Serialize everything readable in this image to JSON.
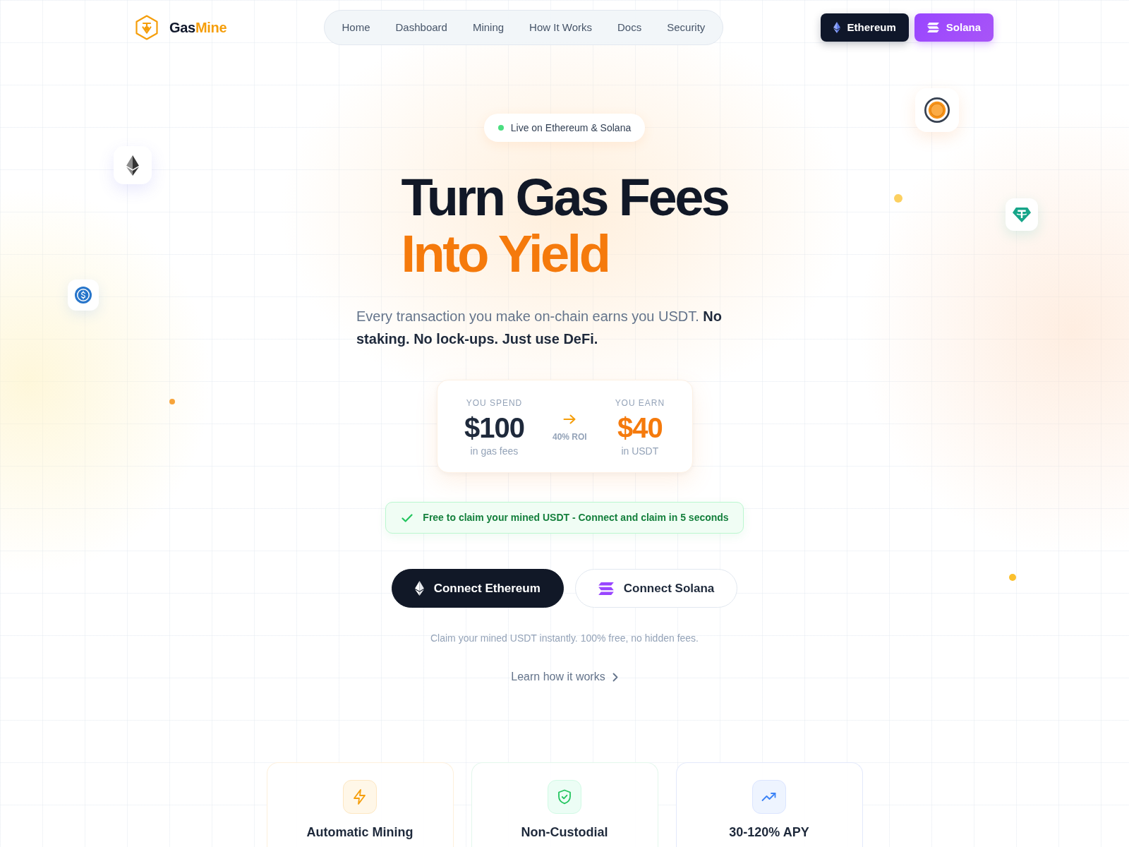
{
  "brand": {
    "name_start": "Gas",
    "name_end": "Mine"
  },
  "nav": [
    "Home",
    "Dashboard",
    "Mining",
    "How It Works",
    "Docs",
    "Security"
  ],
  "network_buttons": [
    {
      "label": "Ethereum",
      "kind": "ethereum"
    },
    {
      "label": "Solana",
      "kind": "solana"
    }
  ],
  "hero": {
    "badge": "Live on Ethereum & Solana",
    "title_line_1": "Turn Gas Fees",
    "title_line_2": "Into Yield",
    "subtitle": "Every transaction you make on-chain earns you USDT. **No staking. No lock-ups. Just use DeFi.**"
  },
  "calculator": {
    "spend": {
      "label": "YOU SPEND",
      "amount": "$100",
      "note": "in gas fees"
    },
    "ratio": "40% ROI",
    "earn": {
      "label": "YOU EARN",
      "amount": "$40",
      "note": "in USDT"
    }
  },
  "notice": "Free to claim your mined USDT - Connect and claim in 5 seconds",
  "connect_buttons": [
    {
      "label": "Connect Ethereum",
      "kind": "ethereum"
    },
    {
      "label": "Connect Solana",
      "kind": "solana"
    }
  ],
  "footnote": "Claim your mined USDT instantly. 100% free, no hidden fees.",
  "learn_link": "Learn how it works",
  "features": [
    {
      "title": "Automatic Mining",
      "kind": "speed"
    },
    {
      "title": "Non-Custodial",
      "kind": "security"
    },
    {
      "title": "30-120% APY",
      "kind": "growth"
    }
  ]
}
